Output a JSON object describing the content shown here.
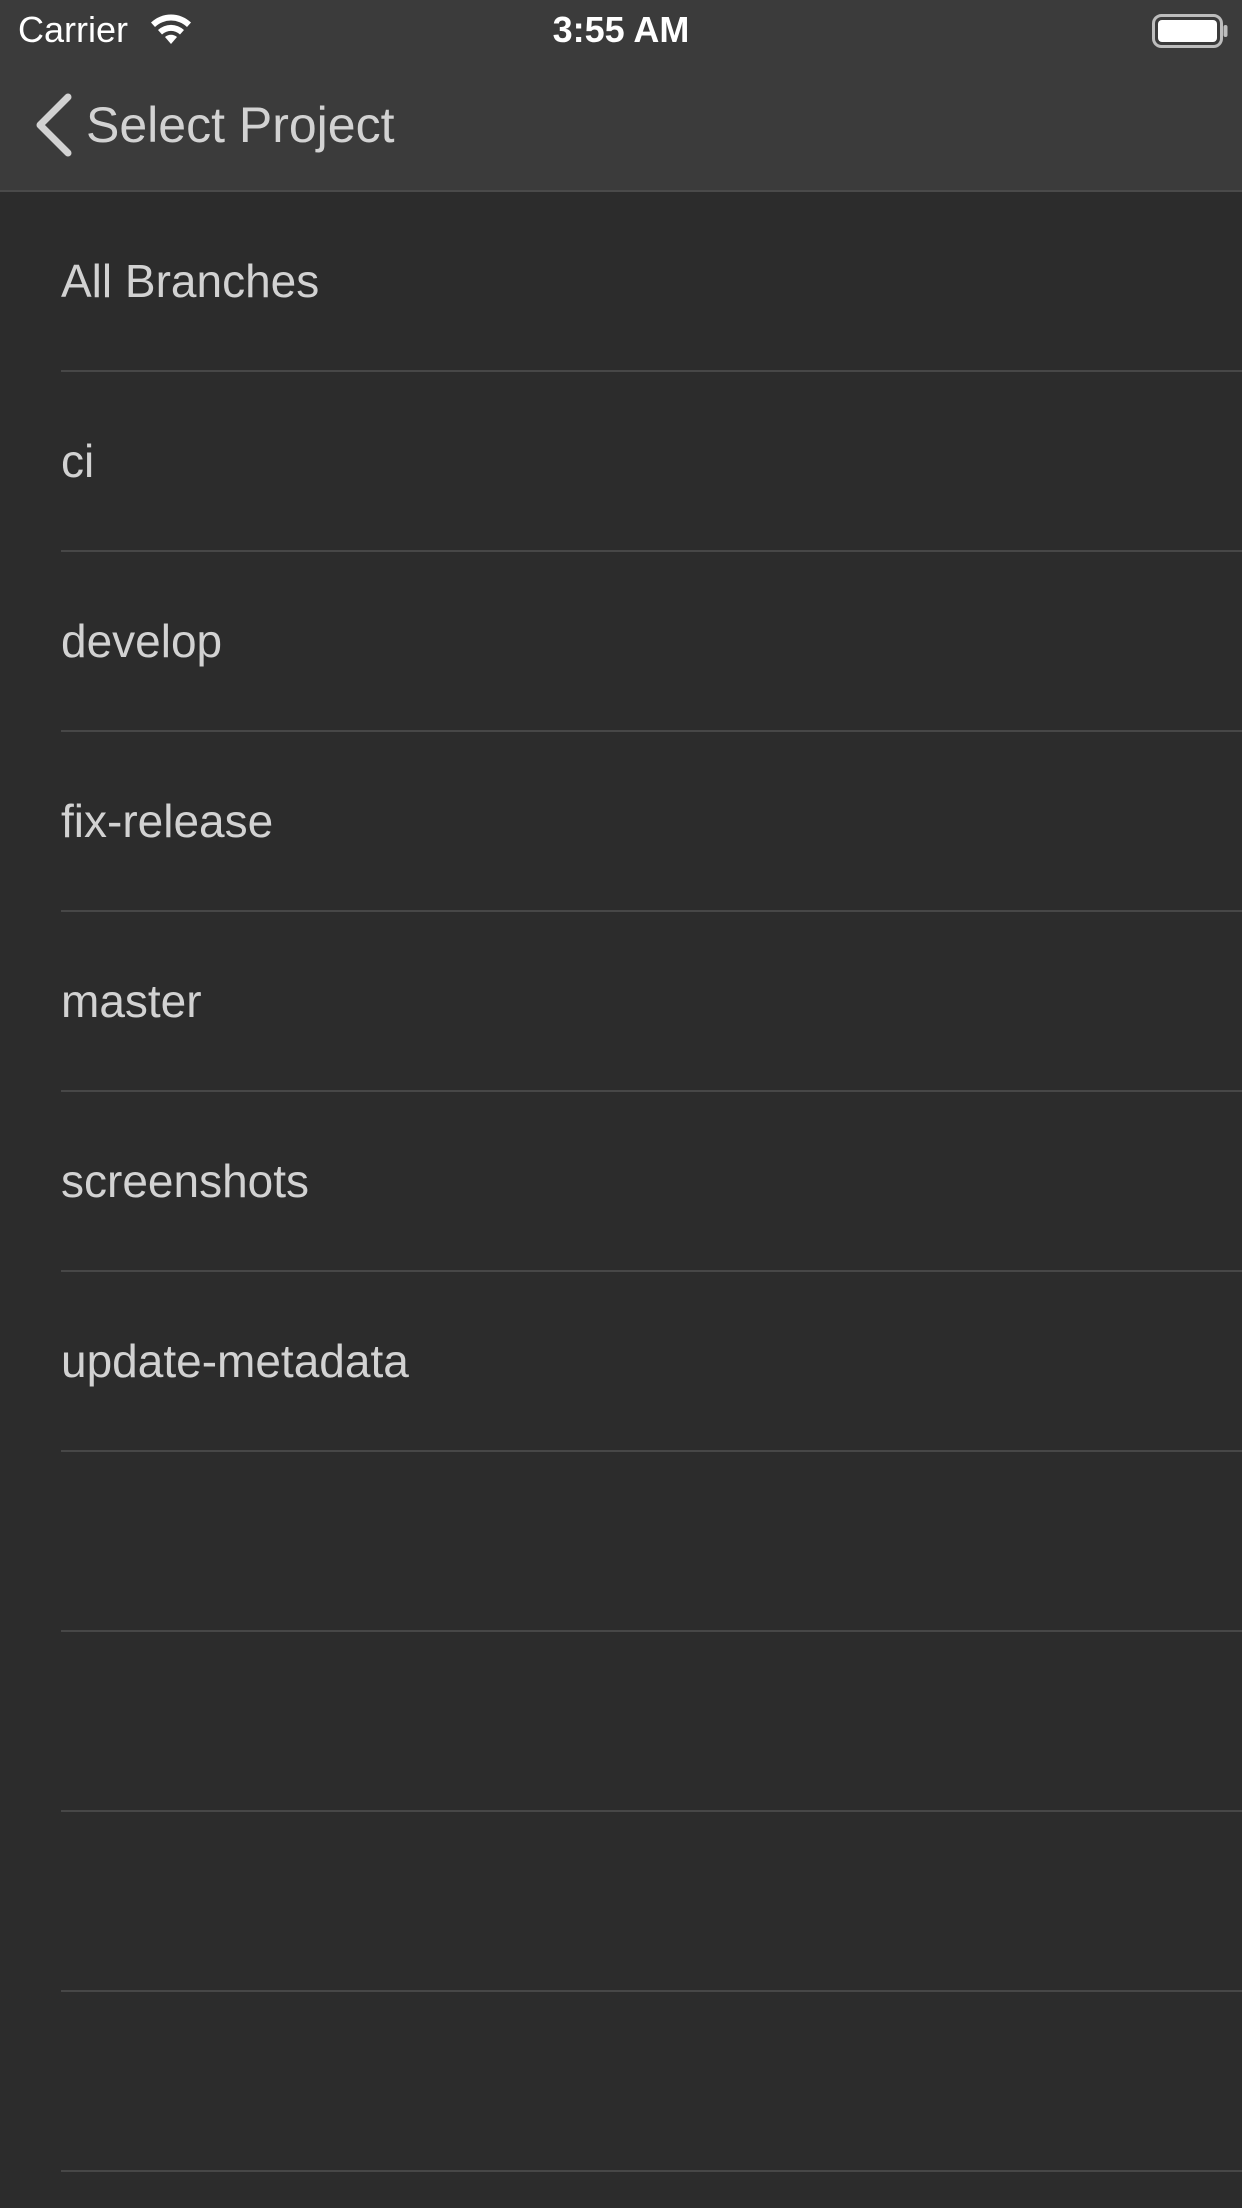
{
  "status_bar": {
    "carrier": "Carrier",
    "time": "3:55 AM",
    "icons": [
      "wifi-icon",
      "battery-icon"
    ]
  },
  "nav": {
    "back_label": "Select Project",
    "back_icon": "chevron-left-icon"
  },
  "branches": {
    "items": [
      {
        "label": "All Branches"
      },
      {
        "label": "ci"
      },
      {
        "label": "develop"
      },
      {
        "label": "fix-release"
      },
      {
        "label": "master"
      },
      {
        "label": "screenshots"
      },
      {
        "label": "update-metadata"
      },
      {
        "label": ""
      },
      {
        "label": ""
      },
      {
        "label": ""
      },
      {
        "label": ""
      }
    ]
  },
  "colors": {
    "background": "#2c2c2c",
    "bar": "#3b3b3b",
    "text": "#d2d2d2",
    "separator": "#474747"
  }
}
